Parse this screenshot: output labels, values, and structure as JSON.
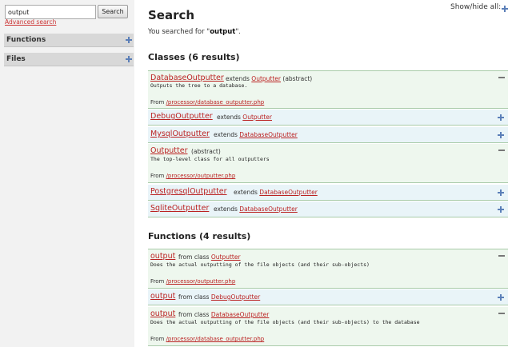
{
  "sidebar": {
    "search_value": "output",
    "search_button": "Search",
    "advanced_link": "Advanced search",
    "panels": [
      {
        "label": "Functions",
        "icon": "plus-icon"
      },
      {
        "label": "Files",
        "icon": "plus-icon"
      }
    ]
  },
  "main": {
    "title": "Search",
    "show_hide_label": "Show/hide all:",
    "summary_prefix": "You searched for \"",
    "summary_term": "output",
    "summary_suffix": "\".",
    "classes_heading": "Classes (6 results)",
    "functions_heading": "Functions (4 results)",
    "classes": [
      {
        "name": "DatabaseOutputter",
        "rel": "extends",
        "parent": "Outputter",
        "suffix": "(abstract)",
        "desc": "Outputs the tree to a database.",
        "from_label": "From",
        "file": "/processor/database_outputter.php",
        "state": "expanded"
      },
      {
        "name": "DebugOutputter",
        "rel": "extends",
        "parent": "Outputter",
        "state": "collapsed"
      },
      {
        "name": "MysqlOutputter",
        "rel": "extends",
        "parent": "DatabaseOutputter",
        "state": "collapsed"
      },
      {
        "name": "Outputter",
        "suffix": "(abstract)",
        "desc": "The top-level class for all outputters",
        "from_label": "From",
        "file": "/processor/outputter.php",
        "state": "expanded"
      },
      {
        "name": "PostgresqlOutputter",
        "rel": "extends",
        "parent": "DatabaseOutputter",
        "state": "collapsed"
      },
      {
        "name": "SqliteOutputter",
        "rel": "extends",
        "parent": "DatabaseOutputter",
        "state": "collapsed"
      }
    ],
    "functions": [
      {
        "name": "output",
        "rel": "from class",
        "parent": "Outputter",
        "desc": "Does the actual outputting of the file objects (and their sub-objects)",
        "from_label": "From",
        "file": "/processor/outputter.php",
        "state": "expanded"
      },
      {
        "name": "output",
        "rel": "from class",
        "parent": "DebugOutputter",
        "state": "collapsed"
      },
      {
        "name": "output",
        "rel": "from class",
        "parent": "DatabaseOutputter",
        "desc": "Does the actual outputting of the file objects (and their sub-objects) to the database",
        "from_label": "From",
        "file": "/processor/database_outputter.php",
        "state": "expanded"
      }
    ]
  },
  "colors": {
    "link": "#b22222",
    "expanded_bg": "#eef7ee",
    "collapsed_bg": "#e9f4f8",
    "icon_blue": "#5b7fb8"
  }
}
